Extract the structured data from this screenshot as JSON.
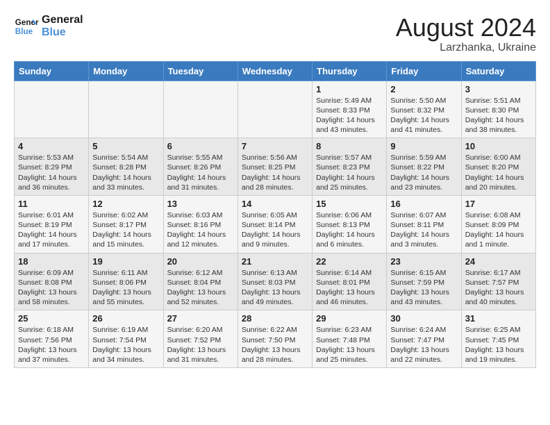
{
  "header": {
    "logo_line1": "General",
    "logo_line2": "Blue",
    "month_year": "August 2024",
    "location": "Larzhanka, Ukraine"
  },
  "weekdays": [
    "Sunday",
    "Monday",
    "Tuesday",
    "Wednesday",
    "Thursday",
    "Friday",
    "Saturday"
  ],
  "weeks": [
    [
      {
        "day": "",
        "info": ""
      },
      {
        "day": "",
        "info": ""
      },
      {
        "day": "",
        "info": ""
      },
      {
        "day": "",
        "info": ""
      },
      {
        "day": "1",
        "info": "Sunrise: 5:49 AM\nSunset: 8:33 PM\nDaylight: 14 hours\nand 43 minutes."
      },
      {
        "day": "2",
        "info": "Sunrise: 5:50 AM\nSunset: 8:32 PM\nDaylight: 14 hours\nand 41 minutes."
      },
      {
        "day": "3",
        "info": "Sunrise: 5:51 AM\nSunset: 8:30 PM\nDaylight: 14 hours\nand 38 minutes."
      }
    ],
    [
      {
        "day": "4",
        "info": "Sunrise: 5:53 AM\nSunset: 8:29 PM\nDaylight: 14 hours\nand 36 minutes."
      },
      {
        "day": "5",
        "info": "Sunrise: 5:54 AM\nSunset: 8:28 PM\nDaylight: 14 hours\nand 33 minutes."
      },
      {
        "day": "6",
        "info": "Sunrise: 5:55 AM\nSunset: 8:26 PM\nDaylight: 14 hours\nand 31 minutes."
      },
      {
        "day": "7",
        "info": "Sunrise: 5:56 AM\nSunset: 8:25 PM\nDaylight: 14 hours\nand 28 minutes."
      },
      {
        "day": "8",
        "info": "Sunrise: 5:57 AM\nSunset: 8:23 PM\nDaylight: 14 hours\nand 25 minutes."
      },
      {
        "day": "9",
        "info": "Sunrise: 5:59 AM\nSunset: 8:22 PM\nDaylight: 14 hours\nand 23 minutes."
      },
      {
        "day": "10",
        "info": "Sunrise: 6:00 AM\nSunset: 8:20 PM\nDaylight: 14 hours\nand 20 minutes."
      }
    ],
    [
      {
        "day": "11",
        "info": "Sunrise: 6:01 AM\nSunset: 8:19 PM\nDaylight: 14 hours\nand 17 minutes."
      },
      {
        "day": "12",
        "info": "Sunrise: 6:02 AM\nSunset: 8:17 PM\nDaylight: 14 hours\nand 15 minutes."
      },
      {
        "day": "13",
        "info": "Sunrise: 6:03 AM\nSunset: 8:16 PM\nDaylight: 14 hours\nand 12 minutes."
      },
      {
        "day": "14",
        "info": "Sunrise: 6:05 AM\nSunset: 8:14 PM\nDaylight: 14 hours\nand 9 minutes."
      },
      {
        "day": "15",
        "info": "Sunrise: 6:06 AM\nSunset: 8:13 PM\nDaylight: 14 hours\nand 6 minutes."
      },
      {
        "day": "16",
        "info": "Sunrise: 6:07 AM\nSunset: 8:11 PM\nDaylight: 14 hours\nand 3 minutes."
      },
      {
        "day": "17",
        "info": "Sunrise: 6:08 AM\nSunset: 8:09 PM\nDaylight: 14 hours\nand 1 minute."
      }
    ],
    [
      {
        "day": "18",
        "info": "Sunrise: 6:09 AM\nSunset: 8:08 PM\nDaylight: 13 hours\nand 58 minutes."
      },
      {
        "day": "19",
        "info": "Sunrise: 6:11 AM\nSunset: 8:06 PM\nDaylight: 13 hours\nand 55 minutes."
      },
      {
        "day": "20",
        "info": "Sunrise: 6:12 AM\nSunset: 8:04 PM\nDaylight: 13 hours\nand 52 minutes."
      },
      {
        "day": "21",
        "info": "Sunrise: 6:13 AM\nSunset: 8:03 PM\nDaylight: 13 hours\nand 49 minutes."
      },
      {
        "day": "22",
        "info": "Sunrise: 6:14 AM\nSunset: 8:01 PM\nDaylight: 13 hours\nand 46 minutes."
      },
      {
        "day": "23",
        "info": "Sunrise: 6:15 AM\nSunset: 7:59 PM\nDaylight: 13 hours\nand 43 minutes."
      },
      {
        "day": "24",
        "info": "Sunrise: 6:17 AM\nSunset: 7:57 PM\nDaylight: 13 hours\nand 40 minutes."
      }
    ],
    [
      {
        "day": "25",
        "info": "Sunrise: 6:18 AM\nSunset: 7:56 PM\nDaylight: 13 hours\nand 37 minutes."
      },
      {
        "day": "26",
        "info": "Sunrise: 6:19 AM\nSunset: 7:54 PM\nDaylight: 13 hours\nand 34 minutes."
      },
      {
        "day": "27",
        "info": "Sunrise: 6:20 AM\nSunset: 7:52 PM\nDaylight: 13 hours\nand 31 minutes."
      },
      {
        "day": "28",
        "info": "Sunrise: 6:22 AM\nSunset: 7:50 PM\nDaylight: 13 hours\nand 28 minutes."
      },
      {
        "day": "29",
        "info": "Sunrise: 6:23 AM\nSunset: 7:48 PM\nDaylight: 13 hours\nand 25 minutes."
      },
      {
        "day": "30",
        "info": "Sunrise: 6:24 AM\nSunset: 7:47 PM\nDaylight: 13 hours\nand 22 minutes."
      },
      {
        "day": "31",
        "info": "Sunrise: 6:25 AM\nSunset: 7:45 PM\nDaylight: 13 hours\nand 19 minutes."
      }
    ]
  ]
}
